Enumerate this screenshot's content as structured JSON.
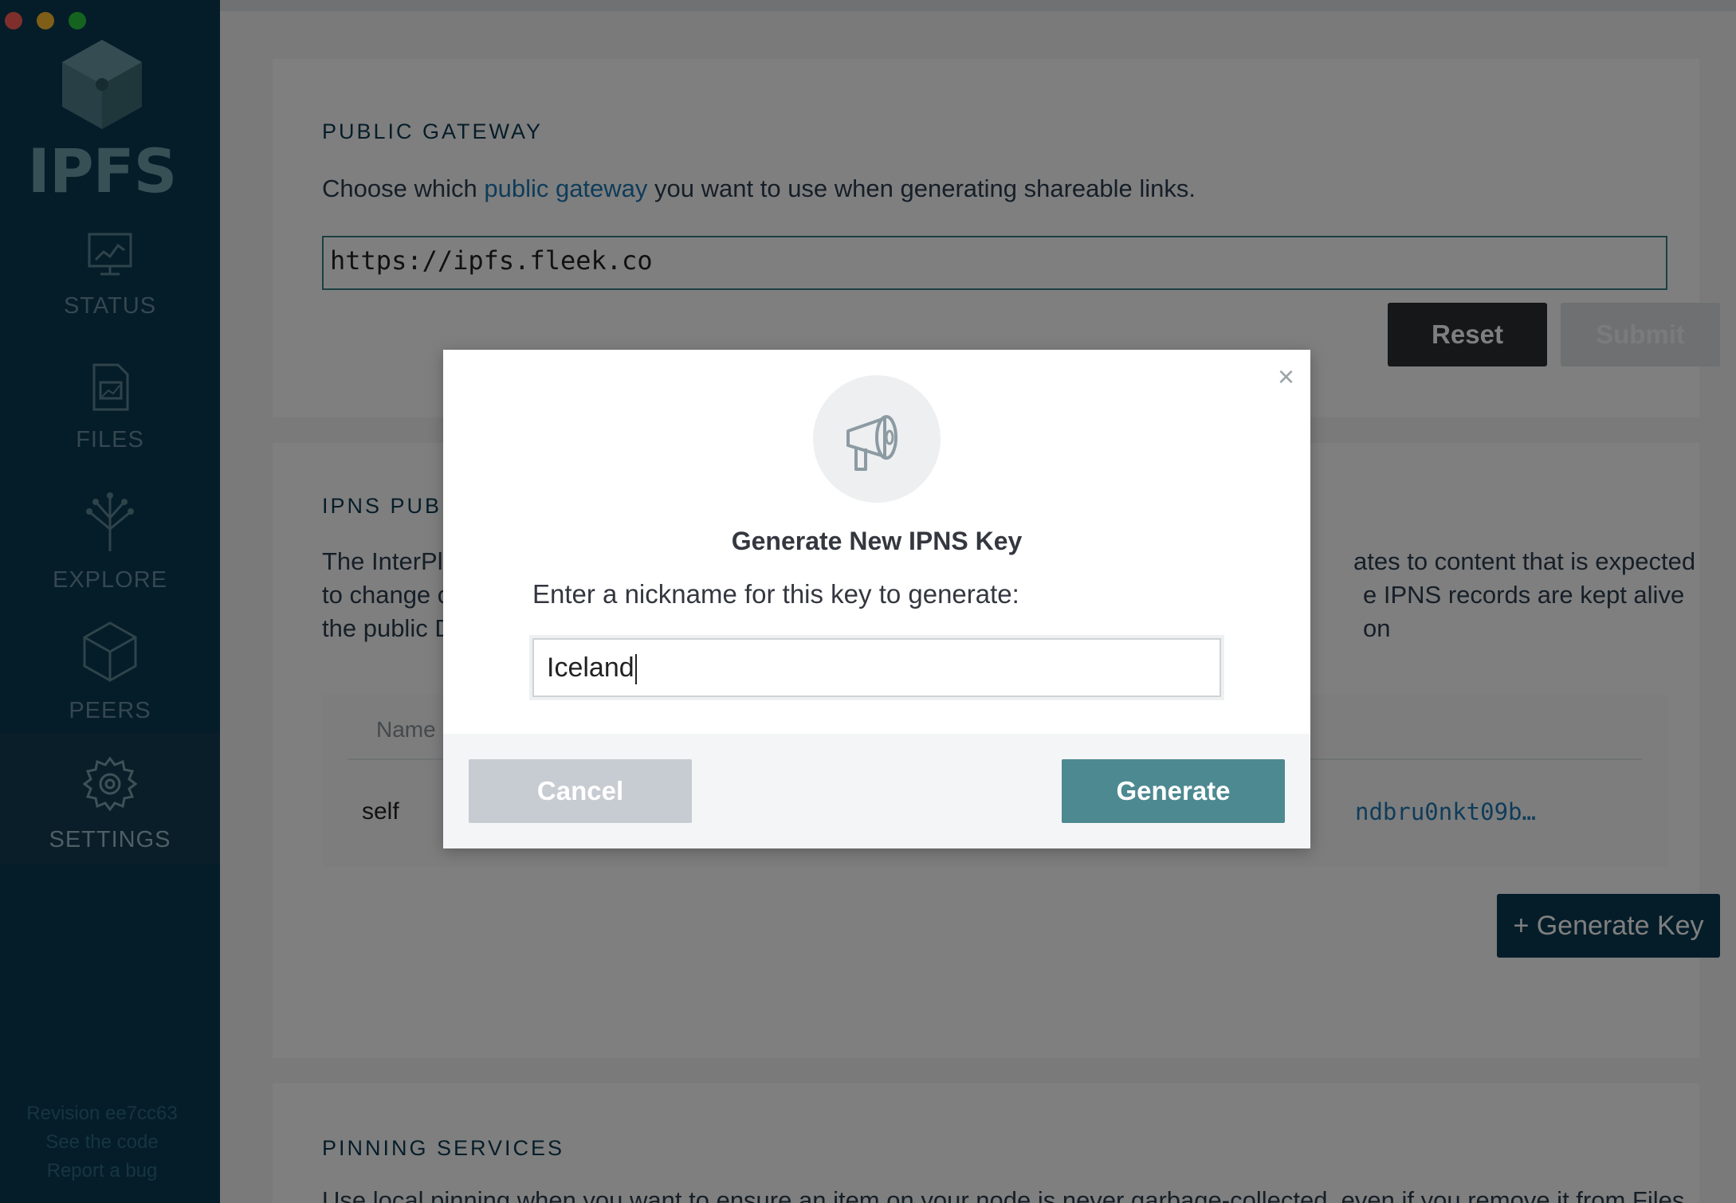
{
  "sidebar": {
    "logo_text": "IPFS",
    "items": [
      {
        "label": "STATUS",
        "icon": "status-icon"
      },
      {
        "label": "FILES",
        "icon": "files-icon"
      },
      {
        "label": "EXPLORE",
        "icon": "explore-icon"
      },
      {
        "label": "PEERS",
        "icon": "peers-icon"
      },
      {
        "label": "SETTINGS",
        "icon": "settings-icon",
        "active": true
      }
    ],
    "footer": {
      "revision": "Revision ee7cc63",
      "see_code": "See the code",
      "report_bug": "Report a bug"
    }
  },
  "public_gateway": {
    "title": "PUBLIC GATEWAY",
    "desc_before": "Choose which ",
    "desc_link": "public gateway",
    "desc_after": " you want to use when generating shareable links.",
    "input_value": "https://ipfs.fleek.co",
    "reset_label": "Reset",
    "submit_label": "Submit"
  },
  "ipns": {
    "title_partial": "IPNS PUB",
    "line1_left": "The InterPla",
    "line1_right": "ates to content that is expected",
    "line2_left": "to change c",
    "line2_right": "e IPNS records are kept alive on",
    "line3_left": "the public D",
    "table_header_name": "Name",
    "row_name": "self",
    "row_id_partial": "ndbru0nkt09b…",
    "generate_key_label": "+ Generate Key"
  },
  "pinning": {
    "title": "PINNING SERVICES",
    "desc_partial": "Use local pinning when you want to ensure an item on your node is never garbage-collected, even if you remove it from Files."
  },
  "modal": {
    "title": "Generate New IPNS Key",
    "description": "Enter a nickname for this key to generate:",
    "input_value": "Iceland",
    "cancel_label": "Cancel",
    "generate_label": "Generate",
    "close_symbol": "×",
    "icon": "megaphone-icon"
  },
  "colors": {
    "sidebar_bg": "#0b3a53",
    "accent_teal": "#4d8991",
    "link_blue": "#1f78b4"
  }
}
